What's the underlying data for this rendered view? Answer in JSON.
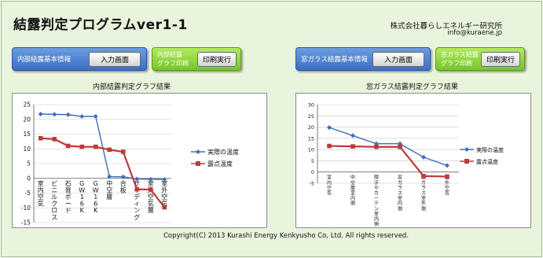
{
  "header": {
    "title": "結露判定プログラムver1-1",
    "company": "株式会社暮らしエネルギー研究所",
    "email": "info@kuraene.jp"
  },
  "left": {
    "info_label": "内部結露基本情報",
    "input_button": "入力画面",
    "print_label_1": "内部結露",
    "print_label_2": "グラフ印刷",
    "print_button": "印刷実行",
    "chart_title": "内部結露判定グラフ結果"
  },
  "right": {
    "info_label": "窓ガラス結露基本情報",
    "input_button": "入力画面",
    "print_label_1": "窓ガラス結露",
    "print_label_2": "グラフ印刷",
    "print_button": "印刷実行",
    "chart_title": "窓ガラス結露判定グラフ結果"
  },
  "footer": {
    "copyright": "Copyright(C) 2013 Kurashi Energy Kenkyusho Co, Ltd. All rights reserved."
  },
  "colors": {
    "series_actual": "#3f6fb8",
    "series_dew": "#c0393b",
    "panel_blue": "#4a7fd0",
    "panel_green": "#8ed33a",
    "background": "#e9f4dd"
  },
  "chart_data": [
    {
      "type": "line",
      "categories": [
        "室内空気",
        "ビニルクロス",
        "石膏ボード",
        "GW16K",
        "GW16K",
        "中空層",
        "合板",
        "サイディング",
        "室外空気層",
        "室外空気"
      ],
      "series": [
        {
          "name": "実際の温度",
          "values": [
            21.8,
            21.7,
            21.6,
            21.0,
            21.0,
            0.6,
            0.5,
            -0.2,
            -0.3,
            -0.4
          ]
        },
        {
          "name": "露点温度",
          "values": [
            13.6,
            13.3,
            11.0,
            10.7,
            10.7,
            9.7,
            9.0,
            -3.7,
            -3.8,
            -9.8
          ]
        }
      ],
      "yticks": [
        "25",
        "20",
        "15",
        "10",
        "5",
        "0",
        "-5",
        "-10",
        "-15"
      ],
      "ylim": [
        -15,
        25
      ]
    },
    {
      "type": "line",
      "categories": [
        "室内空気",
        "中空層室内側",
        "障子やカーテン室内側",
        "窓ガラス室内側",
        "窓ガラス室外側",
        "室外空気"
      ],
      "series": [
        {
          "name": "実際の温度",
          "values": [
            19.8,
            16.2,
            12.6,
            12.6,
            6.6,
            2.9
          ]
        },
        {
          "name": "露点温度",
          "values": [
            11.6,
            11.4,
            11.2,
            11.2,
            -1.8,
            -2.0
          ]
        }
      ],
      "yticks": [
        "30",
        "25",
        "20",
        "15",
        "10",
        "5",
        "0",
        "-5"
      ],
      "ylim": [
        -5,
        30
      ]
    }
  ]
}
